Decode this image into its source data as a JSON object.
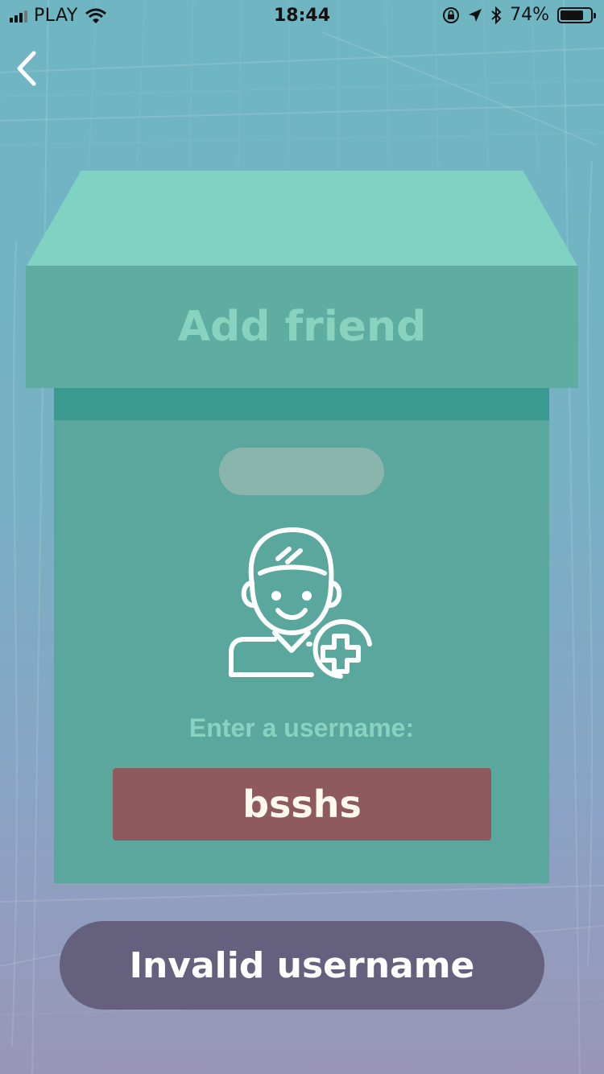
{
  "status_bar": {
    "carrier": "PLAY",
    "time": "18:44",
    "battery_percent": "74%",
    "icons": [
      "signal-icon",
      "wifi-icon",
      "orientation-lock-icon",
      "location-arrow-icon",
      "bluetooth-icon",
      "battery-icon"
    ]
  },
  "nav": {
    "back_icon": "chevron-left-icon"
  },
  "card": {
    "title": "Add friend",
    "icon": "add-user-icon",
    "prompt": "Enter a username:",
    "username_value": "bsshs"
  },
  "error": {
    "message": "Invalid username"
  },
  "colors": {
    "lid_top": "#80d3c3",
    "lid_front": "#5fada1",
    "body": "#5aa79e",
    "field_error": "#8f5a5d",
    "pill": "#66607f"
  }
}
